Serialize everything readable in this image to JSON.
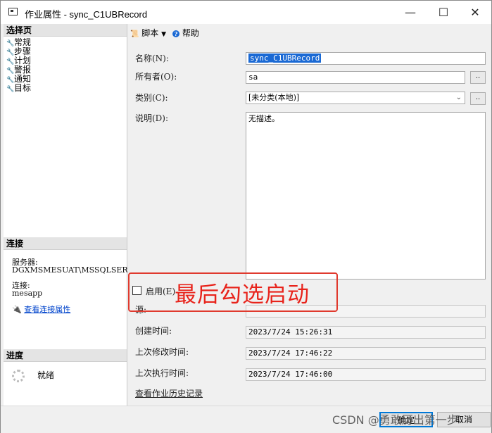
{
  "window": {
    "title": "作业属性 - sync_C1UBRecord",
    "minimize": "—",
    "maximize": "☐",
    "close": "✕"
  },
  "left_panel": {
    "select_page_header": "选择页",
    "pages": [
      {
        "label": "常规",
        "icon": "wrench-icon"
      },
      {
        "label": "步骤",
        "icon": "wrench-icon"
      },
      {
        "label": "计划",
        "icon": "wrench-icon"
      },
      {
        "label": "警报",
        "icon": "wrench-icon"
      },
      {
        "label": "通知",
        "icon": "wrench-icon"
      },
      {
        "label": "目标",
        "icon": "wrench-icon"
      }
    ],
    "connection_header": "连接",
    "server_label": "服务器:",
    "server_value": "DGXMSMESUAT\\MSSQLSERVERUAT",
    "connection_label": "连接:",
    "connection_value": "mesapp",
    "view_connection_link": "查看连接属性",
    "progress_header": "进度",
    "progress_status": "就绪"
  },
  "toolbar": {
    "script_label": "脚本",
    "help_label": "帮助"
  },
  "form": {
    "name_label": "名称(N):",
    "name_value": "sync_C1UBRecord",
    "owner_label": "所有者(O):",
    "owner_value": "sa",
    "category_label": "类别(C):",
    "category_value": "[未分类(本地)]",
    "description_label": "说明(D):",
    "description_value": "无描述。",
    "enabled_label": "启用(E)",
    "source_label": "源:",
    "source_value": "",
    "created_label": "创建时间:",
    "created_value": "2023/7/24 15:26:31",
    "modified_label": "上次修改时间:",
    "modified_value": "2023/7/24 17:46:22",
    "executed_label": "上次执行时间:",
    "executed_value": "2023/7/24 17:46:00",
    "history_link": "查看作业历史记录",
    "browse_button": ".."
  },
  "footer": {
    "ok_label": "确定",
    "cancel_label": "取消"
  },
  "annotation": {
    "text": "最后勾选启动"
  },
  "watermark": {
    "text": "CSDN @勇敢历出第一步"
  },
  "colors": {
    "annotation": "#e8231b",
    "link": "#0044cc",
    "selection": "#1a69d4"
  }
}
